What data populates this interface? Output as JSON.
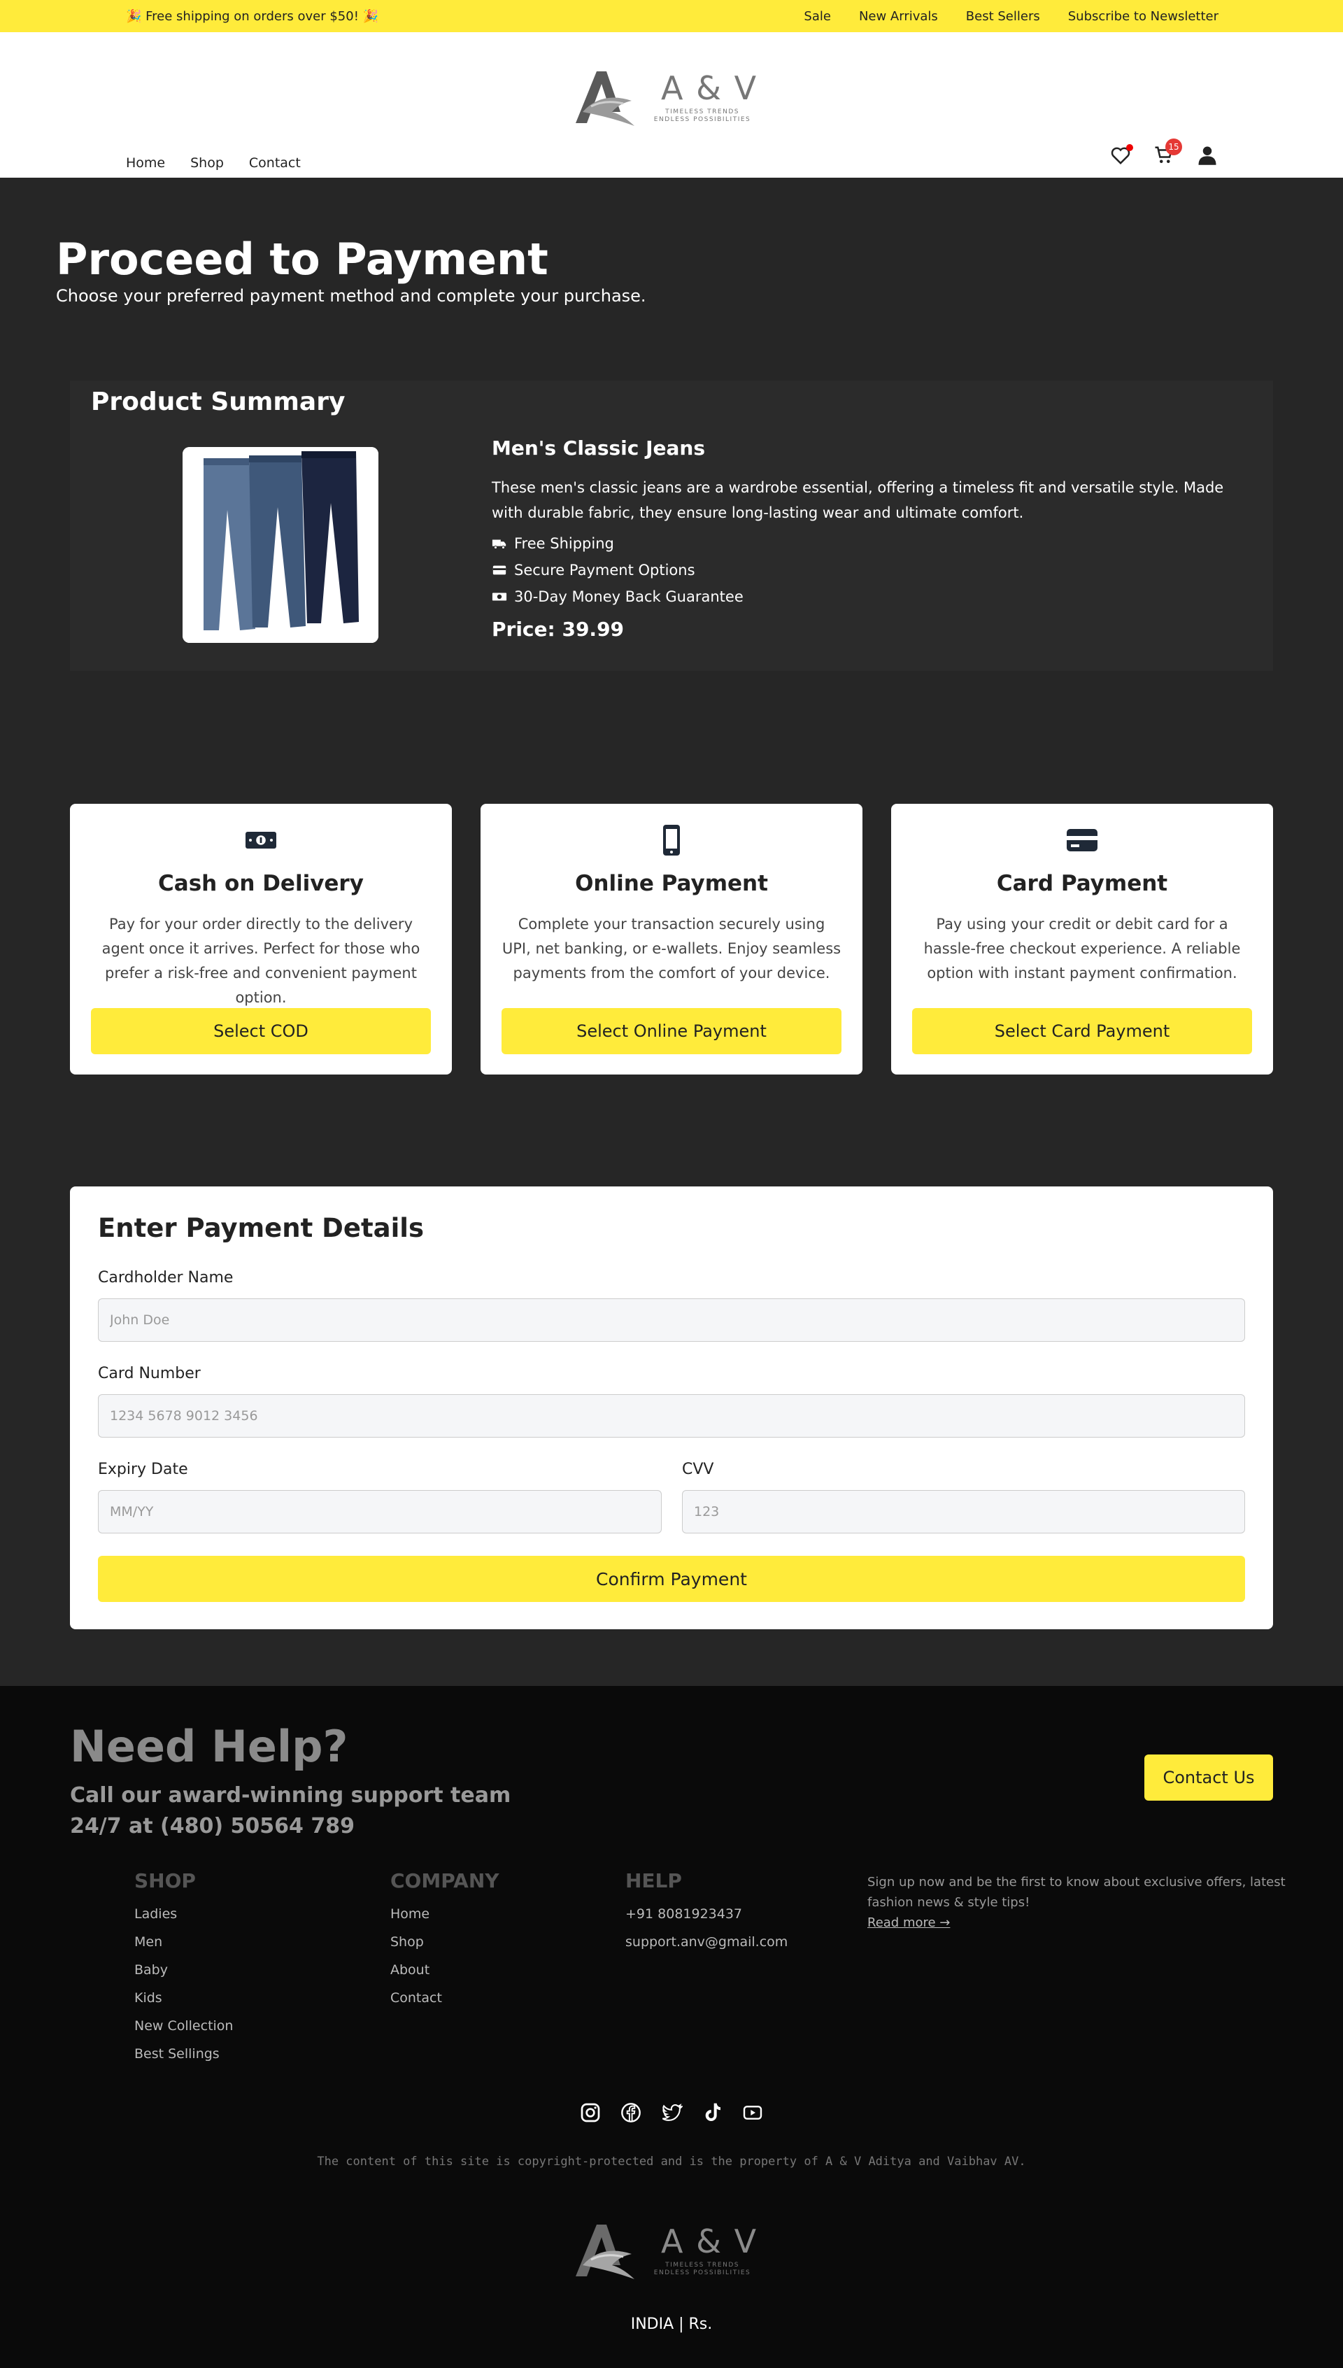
{
  "topbar": {
    "promo": "🎉 Free shipping on orders over $50! 🎉",
    "links": [
      "Sale",
      "New Arrivals",
      "Best Sellers",
      "Subscribe to Newsletter"
    ]
  },
  "brand": {
    "name": "A & V",
    "tagline_1": "TIMELESS TRENDS",
    "tagline_2": "ENDLESS POSSIBILITIES"
  },
  "nav": {
    "items": [
      "Home",
      "Shop",
      "Contact"
    ],
    "cart_count": "15",
    "icons": [
      "heart-icon",
      "cart-icon",
      "user-icon"
    ]
  },
  "page": {
    "title": "Proceed to Payment",
    "subtitle": "Choose your preferred payment method and complete your purchase."
  },
  "summary": {
    "heading": "Product Summary",
    "product_name": "Men's Classic Jeans",
    "description": "These men's classic jeans are a wardrobe essential, offering a timeless fit and versatile style. Made with durable fabric, they ensure long-lasting wear and ultimate comfort.",
    "features": [
      {
        "icon": "truck-icon",
        "label": "Free Shipping"
      },
      {
        "icon": "credit-card-icon",
        "label": "Secure Payment Options"
      },
      {
        "icon": "money-icon",
        "label": "30-Day Money Back Guarantee"
      }
    ],
    "price": "Price: 39.99"
  },
  "methods": [
    {
      "icon": "cash-icon",
      "title": "Cash on Delivery",
      "description": "Pay for your order directly to the delivery agent once it arrives. Perfect for those who prefer a risk-free and convenient payment option.",
      "button": "Select COD"
    },
    {
      "icon": "mobile-icon",
      "title": "Online Payment",
      "description": "Complete your transaction securely using UPI, net banking, or e-wallets. Enjoy seamless payments from the comfort of your device.",
      "button": "Select Online Payment"
    },
    {
      "icon": "card-icon",
      "title": "Card Payment",
      "description": "Pay using your credit or debit card for a hassle-free checkout experience. A reliable option with instant payment confirmation.",
      "button": "Select Card Payment"
    }
  ],
  "form": {
    "title": "Enter Payment Details",
    "cardholder_label": "Cardholder Name",
    "cardholder_placeholder": "John Doe",
    "card_number_label": "Card Number",
    "card_number_placeholder": "1234 5678 9012 3456",
    "expiry_label": "Expiry Date",
    "expiry_placeholder": "MM/YY",
    "cvv_label": "CVV",
    "cvv_placeholder": "123",
    "confirm": "Confirm Payment"
  },
  "footer": {
    "help_title": "Need Help?",
    "help_text": "Call our award-winning support team 24/7 at (480) 50564 789",
    "contact_button": "Contact Us",
    "shop": {
      "heading": "SHOP",
      "links": [
        "Ladies",
        "Men",
        "Baby",
        "Kids",
        "New Collection",
        "Best Sellings"
      ]
    },
    "company": {
      "heading": "COMPANY",
      "links": [
        "Home",
        "Shop",
        "About",
        "Contact"
      ]
    },
    "help": {
      "heading": "HELP",
      "links": [
        "+91 8081923437",
        "support.anv@gmail.com"
      ]
    },
    "newsletter": "Sign up now and be the first to know about exclusive offers, latest fashion news & style tips!",
    "read_more": "Read more →",
    "socials": [
      "instagram-icon",
      "facebook-icon",
      "twitter-icon",
      "tiktok-icon",
      "youtube-icon"
    ],
    "copyright": "The content of this site is copyright-protected and is the property of A & V Aditya and Vaibhav AV.",
    "region": "INDIA | Rs."
  },
  "colors": {
    "accent": "#ffeb3b",
    "main_bg": "#262626",
    "footer_bg": "#0a0a0a",
    "badge": "#e53935"
  }
}
